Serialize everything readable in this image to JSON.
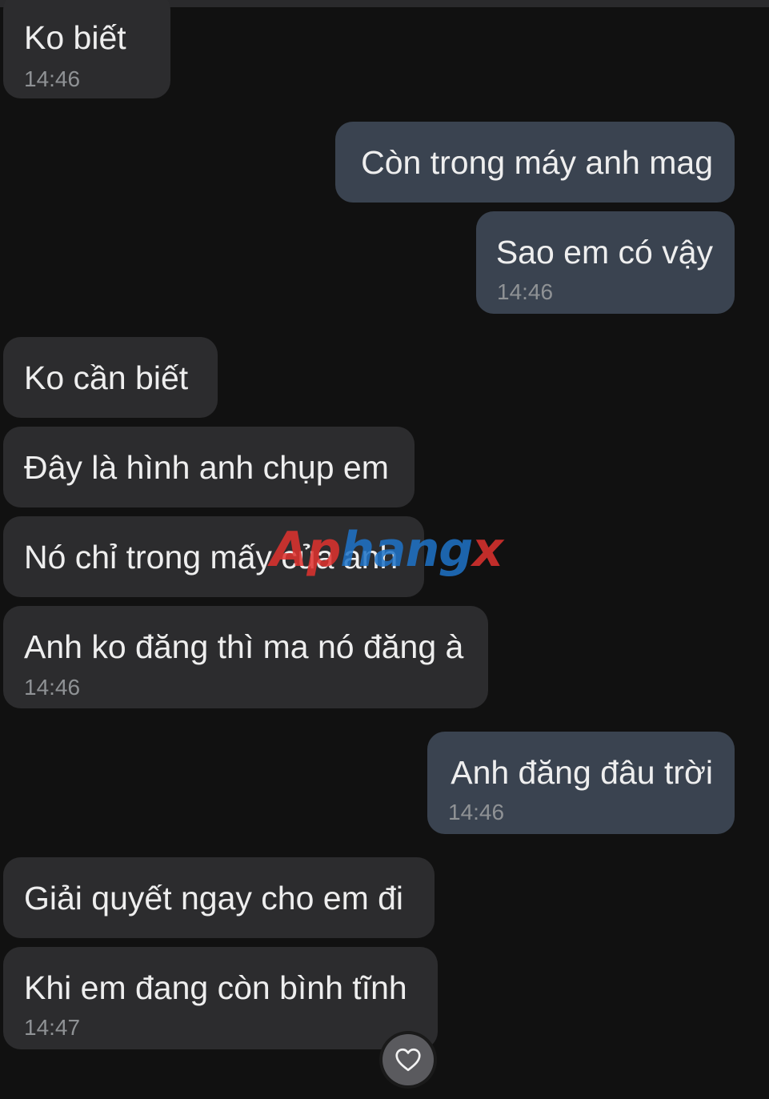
{
  "messages": [
    {
      "direction": "incoming",
      "text": "Ko biết",
      "time": "14:46"
    },
    {
      "direction": "outgoing",
      "text": "Còn trong máy anh mag"
    },
    {
      "direction": "outgoing",
      "text": "Sao em có vậy",
      "time": "14:46"
    },
    {
      "direction": "incoming",
      "text": "Ko cần biết"
    },
    {
      "direction": "incoming",
      "text": "Đây là hình anh chụp em"
    },
    {
      "direction": "incoming",
      "text": "Nó chỉ trong mấy của anh"
    },
    {
      "direction": "incoming",
      "text": "Anh ko đăng thì ma nó đăng à",
      "time": "14:46"
    },
    {
      "direction": "outgoing",
      "text": "Anh đăng đâu trời",
      "time": "14:46"
    },
    {
      "direction": "incoming",
      "text": "Giải quyết ngay cho em đi"
    },
    {
      "direction": "incoming",
      "text": "Khi em đang còn bình tĩnh",
      "time": "14:47"
    }
  ],
  "watermark": {
    "part1": "Ap",
    "part2": "hang",
    "part3": "x"
  },
  "reaction_button": {
    "icon": "heart-icon"
  },
  "colors": {
    "background": "#111111",
    "incoming_bubble": "#2c2c2e",
    "outgoing_bubble": "#3a4350",
    "text": "#eeeeee",
    "time": "#8f9295"
  }
}
